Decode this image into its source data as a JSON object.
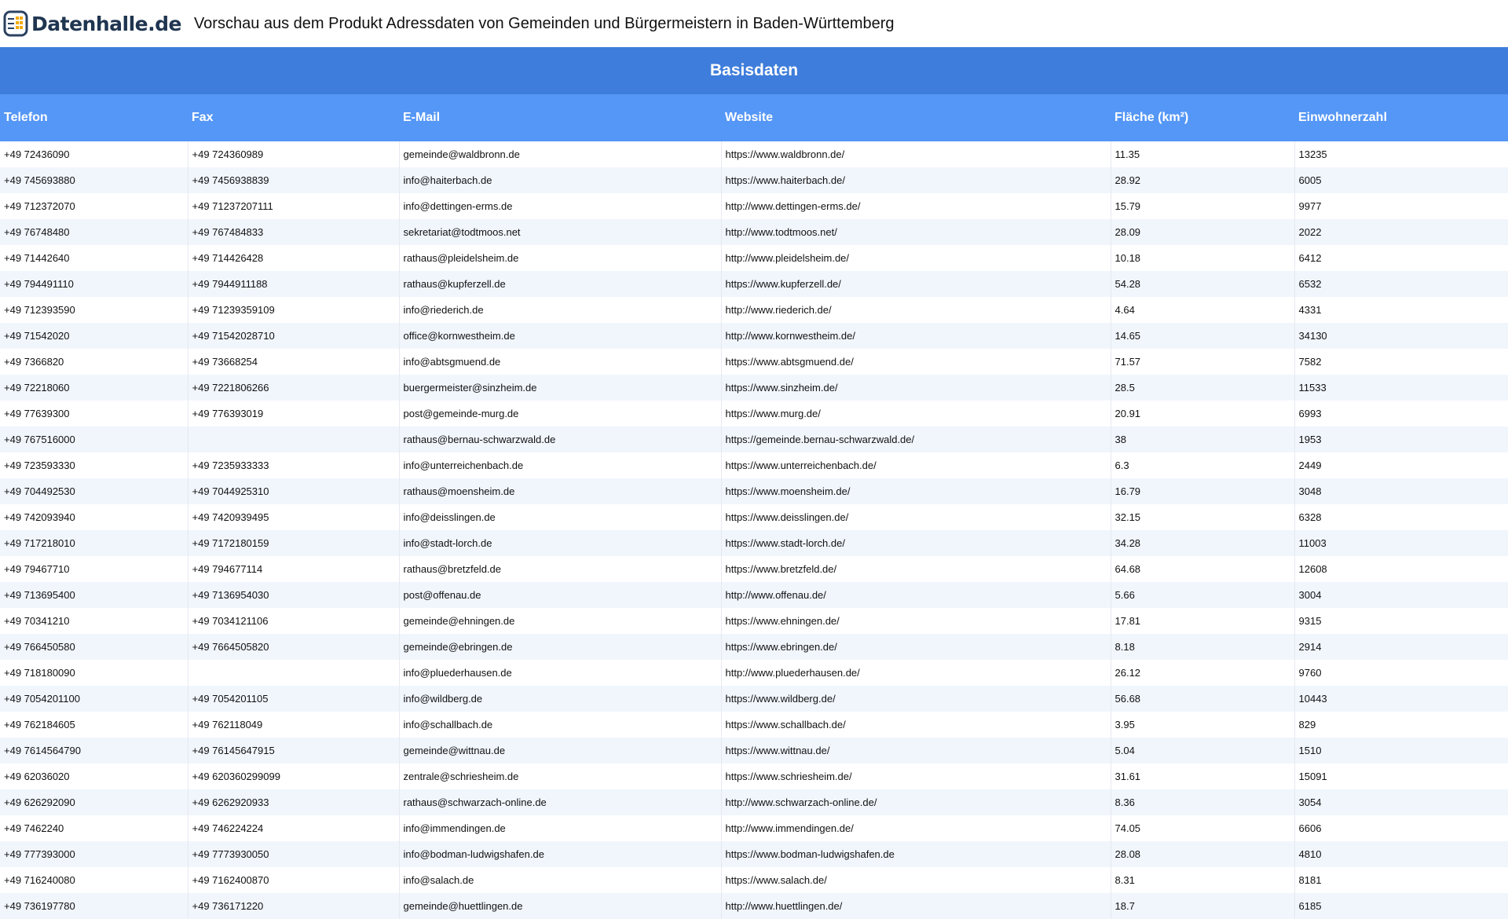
{
  "header": {
    "logo_text": "Datenhalle.de",
    "title": "Vorschau aus dem Produkt Adressdaten von Gemeinden und Bürgermeistern in Baden-Württemberg"
  },
  "table": {
    "group_label": "Basisdaten",
    "columns": [
      "Telefon",
      "Fax",
      "E-Mail",
      "Website",
      "Fläche (km²)",
      "Einwohnerzahl"
    ],
    "rows": [
      [
        "+49 72436090",
        "+49 724360989",
        "gemeinde@waldbronn.de",
        "https://www.waldbronn.de/",
        "11.35",
        "13235"
      ],
      [
        "+49 745693880",
        "+49 7456938839",
        "info@haiterbach.de",
        "https://www.haiterbach.de/",
        "28.92",
        "6005"
      ],
      [
        "+49 712372070",
        "+49 71237207111",
        "info@dettingen-erms.de",
        "http://www.dettingen-erms.de/",
        "15.79",
        "9977"
      ],
      [
        "+49 76748480",
        "+49 767484833",
        "sekretariat@todtmoos.net",
        "http://www.todtmoos.net/",
        "28.09",
        "2022"
      ],
      [
        "+49 71442640",
        "+49 714426428",
        "rathaus@pleidelsheim.de",
        "http://www.pleidelsheim.de/",
        "10.18",
        "6412"
      ],
      [
        "+49 794491110",
        "+49 7944911188",
        "rathaus@kupferzell.de",
        "https://www.kupferzell.de/",
        "54.28",
        "6532"
      ],
      [
        "+49 712393590",
        "+49 71239359109",
        "info@riederich.de",
        "http://www.riederich.de/",
        "4.64",
        "4331"
      ],
      [
        "+49 71542020",
        "+49 71542028710",
        "office@kornwestheim.de",
        "http://www.kornwestheim.de/",
        "14.65",
        "34130"
      ],
      [
        "+49 7366820",
        "+49 73668254",
        "info@abtsgmuend.de",
        "https://www.abtsgmuend.de/",
        "71.57",
        "7582"
      ],
      [
        "+49 72218060",
        "+49 7221806266",
        "buergermeister@sinzheim.de",
        "https://www.sinzheim.de/",
        "28.5",
        "11533"
      ],
      [
        "+49 77639300",
        "+49 776393019",
        "post@gemeinde-murg.de",
        "https://www.murg.de/",
        "20.91",
        "6993"
      ],
      [
        "+49 767516000",
        "",
        "rathaus@bernau-schwarzwald.de",
        "https://gemeinde.bernau-schwarzwald.de/",
        "38",
        "1953"
      ],
      [
        "+49 723593330",
        "+49 7235933333",
        "info@unterreichenbach.de",
        "https://www.unterreichenbach.de/",
        "6.3",
        "2449"
      ],
      [
        "+49 704492530",
        "+49 7044925310",
        "rathaus@moensheim.de",
        "https://www.moensheim.de/",
        "16.79",
        "3048"
      ],
      [
        "+49 742093940",
        "+49 7420939495",
        "info@deisslingen.de",
        "https://www.deisslingen.de/",
        "32.15",
        "6328"
      ],
      [
        "+49 717218010",
        "+49 7172180159",
        "info@stadt-lorch.de",
        "https://www.stadt-lorch.de/",
        "34.28",
        "11003"
      ],
      [
        "+49 79467710",
        "+49 794677114",
        "rathaus@bretzfeld.de",
        "https://www.bretzfeld.de/",
        "64.68",
        "12608"
      ],
      [
        "+49 713695400",
        "+49 7136954030",
        "post@offenau.de",
        "http://www.offenau.de/",
        "5.66",
        "3004"
      ],
      [
        "+49 70341210",
        "+49 7034121106",
        "gemeinde@ehningen.de",
        "https://www.ehningen.de/",
        "17.81",
        "9315"
      ],
      [
        "+49 766450580",
        "+49 7664505820",
        "gemeinde@ebringen.de",
        "https://www.ebringen.de/",
        "8.18",
        "2914"
      ],
      [
        "+49 718180090",
        "",
        "info@pluederhausen.de",
        "http://www.pluederhausen.de/",
        "26.12",
        "9760"
      ],
      [
        "+49 7054201100",
        "+49 7054201105",
        "info@wildberg.de",
        "https://www.wildberg.de/",
        "56.68",
        "10443"
      ],
      [
        "+49 762184605",
        "+49 762118049",
        "info@schallbach.de",
        "https://www.schallbach.de/",
        "3.95",
        "829"
      ],
      [
        "+49 7614564790",
        "+49 76145647915",
        "gemeinde@wittnau.de",
        "https://www.wittnau.de/",
        "5.04",
        "1510"
      ],
      [
        "+49 62036020",
        "+49 620360299099",
        "zentrale@schriesheim.de",
        "https://www.schriesheim.de/",
        "31.61",
        "15091"
      ],
      [
        "+49 626292090",
        "+49 6262920933",
        "rathaus@schwarzach-online.de",
        "http://www.schwarzach-online.de/",
        "8.36",
        "3054"
      ],
      [
        "+49 7462240",
        "+49 746224224",
        "info@immendingen.de",
        "http://www.immendingen.de/",
        "74.05",
        "6606"
      ],
      [
        "+49 777393000",
        "+49 7773930050",
        "info@bodman-ludwigshafen.de",
        "https://www.bodman-ludwigshafen.de",
        "28.08",
        "4810"
      ],
      [
        "+49 716240080",
        "+49 7162400870",
        "info@salach.de",
        "https://www.salach.de/",
        "8.31",
        "8181"
      ],
      [
        "+49 736197780",
        "+49 736171220",
        "gemeinde@huettlingen.de",
        "http://www.huettlingen.de/",
        "18.7",
        "6185"
      ]
    ]
  }
}
